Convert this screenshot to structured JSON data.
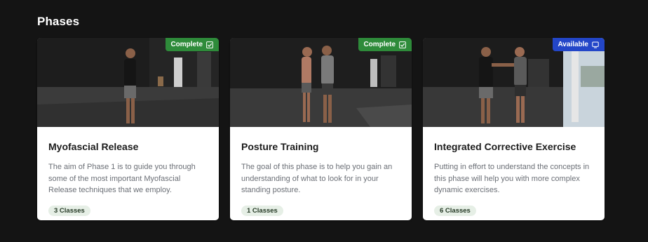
{
  "section": {
    "title": "Phases"
  },
  "colors": {
    "complete": "#2e8b3a",
    "available": "#2346c8",
    "pill_bg": "#e6efe6"
  },
  "cards": [
    {
      "title": "Myofascial Release",
      "description": "The aim of Phase 1 is to guide you through some of the most important Myofascial Release techniques that we employ.",
      "status": "Complete",
      "status_icon": "checkbox-icon",
      "classes": "3 Classes"
    },
    {
      "title": "Posture Training",
      "description": "The goal of this phase is to help you gain an understanding of what to look for in your standing posture.",
      "status": "Complete",
      "status_icon": "checkbox-icon",
      "classes": "1 Classes"
    },
    {
      "title": "Integrated Corrective Exercise",
      "description": "Putting in effort to understand the concepts in this phase will help you with more complex dynamic exercises.",
      "status": "Available",
      "status_icon": "screen-icon",
      "classes": "6 Classes"
    }
  ]
}
